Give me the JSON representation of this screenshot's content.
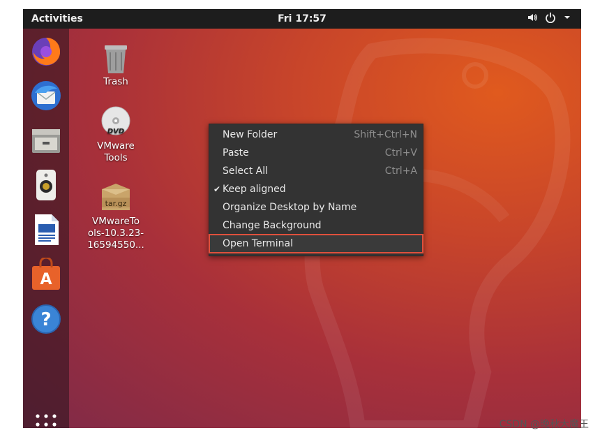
{
  "topbar": {
    "activities": "Activities",
    "clock": "Fri 17:57",
    "tray_icons": [
      "volume-icon",
      "power-icon",
      "chevron-down-icon"
    ]
  },
  "dock": {
    "items": [
      "firefox",
      "thunderbird",
      "files",
      "rhythmbox",
      "libreoffice-writer",
      "ubuntu-software",
      "help"
    ],
    "show_apps_icon": "app-grid-icon"
  },
  "desktop": {
    "icons": [
      {
        "label": "Trash",
        "icon": "trash-icon"
      },
      {
        "label": "VMware\nTools",
        "icon": "dvd-icon"
      },
      {
        "label": "VMwareTo\nols-10.3.23-\n16594550...",
        "icon": "archive-icon",
        "badge": "tar.gz"
      }
    ]
  },
  "context_menu": {
    "items": [
      {
        "label": "New Folder",
        "shortcut": "Shift+Ctrl+N",
        "checked": false
      },
      {
        "label": "Paste",
        "shortcut": "Ctrl+V",
        "checked": false
      },
      {
        "label": "Select All",
        "shortcut": "Ctrl+A",
        "checked": false
      },
      {
        "label": "Keep aligned",
        "shortcut": "",
        "checked": true
      },
      {
        "label": "Organize Desktop by Name",
        "shortcut": "",
        "checked": false
      },
      {
        "label": "Change Background",
        "shortcut": "",
        "checked": false
      },
      {
        "label": "Open Terminal",
        "shortcut": "",
        "checked": false,
        "highlighted": true
      }
    ],
    "check_glyph": "✔"
  },
  "watermark": "CSDN @晚秋大魔王",
  "colors": {
    "topbar": "#1d1d1d",
    "menu_bg": "#333333",
    "highlight_border": "#e0503c"
  }
}
